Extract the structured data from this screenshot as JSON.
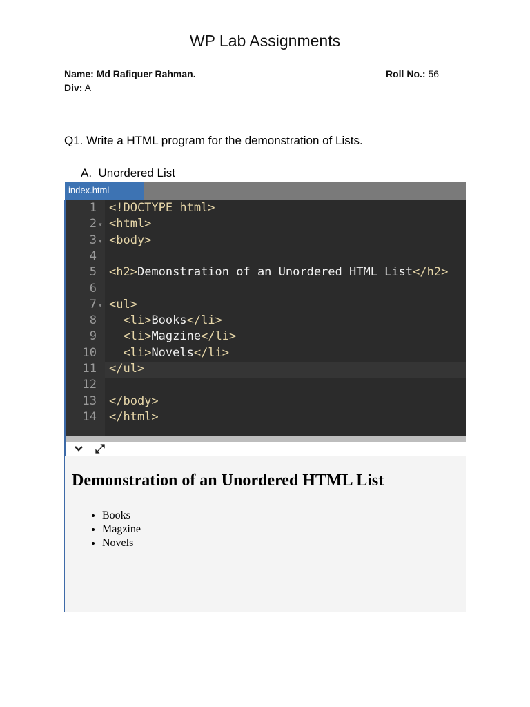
{
  "doc": {
    "title": "WP Lab Assignments",
    "name_label": "Name:",
    "name_value": "Md Rafiquer Rahman.",
    "roll_label": "Roll No.:",
    "roll_value": "56",
    "div_label": "Div:",
    "div_value": "A",
    "question": "Q1. Write a HTML program for the demonstration of Lists.",
    "section": "A.  Unordered List"
  },
  "editor": {
    "tab": "index.html",
    "lines": [
      {
        "n": "1",
        "t": "<!DOCTYPE html>",
        "fold": false
      },
      {
        "n": "2",
        "t": "<html>",
        "fold": true
      },
      {
        "n": "3",
        "t": "<body>",
        "fold": true
      },
      {
        "n": "4",
        "t": "",
        "fold": false
      },
      {
        "n": "5",
        "t": "<h2>Demonstration of an Unordered HTML List</h2>",
        "fold": false
      },
      {
        "n": "6",
        "t": "",
        "fold": false
      },
      {
        "n": "7",
        "t": "<ul>",
        "fold": true
      },
      {
        "n": "8",
        "t": "  <li>Books</li>",
        "fold": false
      },
      {
        "n": "9",
        "t": "  <li>Magzine</li>",
        "fold": false
      },
      {
        "n": "10",
        "t": "  <li>Novels</li>",
        "fold": false
      },
      {
        "n": "11",
        "t": "</ul>",
        "fold": false
      },
      {
        "n": "12",
        "t": "",
        "fold": false
      },
      {
        "n": "13",
        "t": "</body>",
        "fold": false
      },
      {
        "n": "14",
        "t": "</html>",
        "fold": false
      }
    ],
    "icons": [
      "chevron-down-icon",
      "expand-icon"
    ]
  },
  "preview": {
    "heading": "Demonstration of an Unordered HTML List",
    "items": [
      "Books",
      "Magzine",
      "Novels"
    ]
  }
}
